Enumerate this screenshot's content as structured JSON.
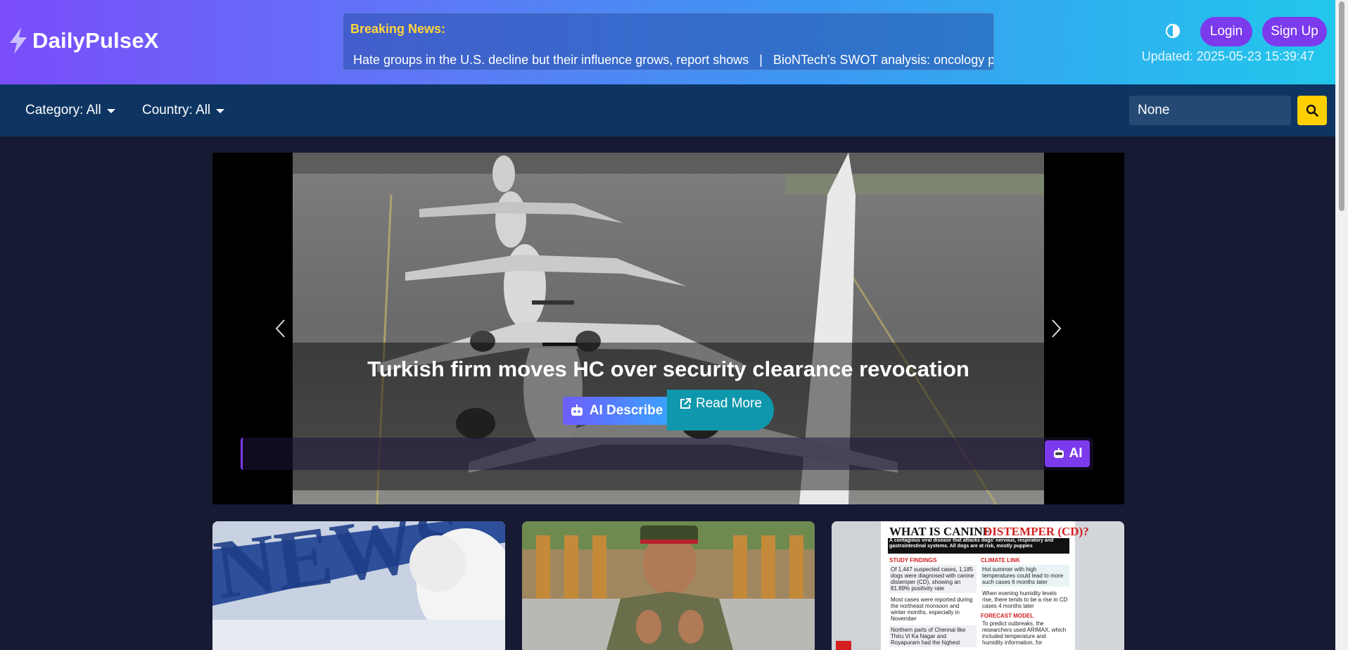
{
  "app": {
    "brand": "DailyPulseX"
  },
  "header": {
    "breaking_label": "Breaking News:",
    "ticker_text": "Hate groups in the U.S. decline but their influence grows, report shows   |   BioNTech's SWOT analysis: oncology pi",
    "login_label": "Login",
    "signup_label": "Sign Up",
    "updated": "Updated: 2025-05-23 15:39:47"
  },
  "filters": {
    "category_label": "Category: All",
    "country_label": "Country: All",
    "search_value": "None"
  },
  "carousel": {
    "title": "Turkish firm moves HC over security clearance revocation",
    "ai_describe_label": "AI Describe",
    "read_more_label": "Read More",
    "ai_label": "AI"
  },
  "cards": {
    "card3_headline": "WHAT IS CANINE",
    "card3_headline_red": "DISTEMPER (CD)?",
    "card3_subhead": "A contagious viral disease that attacks dogs' nervous, respiratory and gastrointestinal systems. All dogs are at risk, mostly puppies",
    "card3_col1_head": "STUDY FINDINGS",
    "card3_col2_head": "CLIMATE LINK",
    "card3_col1_items": [
      "Of 1,447 suspected cases, 1,185 dogs were diagnosed with canine distemper (CD), showing an 81.89% positivity rate",
      "Most cases were reported during the northeast monsoon and winter months, especially in November",
      "Northern parts of Chennai like Thiru Vi Ka Nagar and Royapuram had the highest"
    ],
    "card3_col2_items": [
      "Hot summer with high temperatures could lead to more such cases 6 months later",
      "When evening humidity levels rise, there tends to be a rise in CD cases 4 months later"
    ],
    "card3_col2_head2": "FORECAST MODEL",
    "card3_col2_item3": "To predict outbreaks, the researchers used ARIMAX, which included temperature and humidity information, for"
  },
  "icons": {
    "brand": "bolt-icon",
    "theme": "half-circle-icon",
    "search": "search-icon",
    "robot": "robot-icon",
    "external": "external-link-icon",
    "prev": "chevron-left-icon",
    "next": "chevron-right-icon"
  },
  "colors": {
    "accent_purple": "#7c3aed",
    "ticker_label": "#ffd43b",
    "read_more": "#0f98ad",
    "search_button": "#ffd000",
    "navbar": "#0e3562",
    "page_bg": "#171a33"
  }
}
